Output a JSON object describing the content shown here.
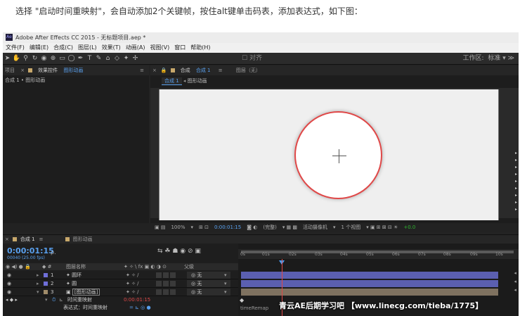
{
  "caption": "选择 \"启动时间重映射\"，会自动添加2个关键帧，按住alt键单击码表，添加表达式，如下图：",
  "window": {
    "logo": "Ae",
    "title": "Adobe After Effects CC 2015 - 无标题项目.aep *"
  },
  "menu": [
    "文件(F)",
    "编辑(E)",
    "合成(C)",
    "图层(L)",
    "效果(T)",
    "动画(A)",
    "视图(V)",
    "窗口",
    "帮助(H)"
  ],
  "toolbar": {
    "snap_label": "对齐",
    "workspace_label": "工作区:",
    "workspace_value": "标准"
  },
  "project_panel": {
    "tabs": [
      "项目",
      "效果控件",
      "图形动画"
    ],
    "breadcrumb": "合成 1 • 图形动画"
  },
  "comp_panel": {
    "tabs": [
      "合成",
      "合成 1",
      "图层（无）"
    ],
    "subtabs": [
      "合成 1",
      "图形动画"
    ],
    "status": {
      "zoom": "100%",
      "timecode": "0:00:01:15",
      "quality": "(完整)",
      "camera": "活动摄像机",
      "views": "1 个视图",
      "exposure": "+0.0"
    }
  },
  "timeline": {
    "tabs": [
      "合成 1",
      "图形动画"
    ],
    "timecode": "0:00:01:15",
    "fps": "00040 (25.00 fps)",
    "search_placeholder": "ρ.",
    "column_header": {
      "name": "图层名称",
      "parent": "父级"
    },
    "layers": [
      {
        "num": "1",
        "name": "圆环",
        "parent": "无",
        "color": "#6f6fd8"
      },
      {
        "num": "2",
        "name": "圆",
        "parent": "无",
        "color": "#6f6fd8"
      },
      {
        "num": "3",
        "name": "[图形动画]",
        "parent": "无",
        "color": "#a08c6a"
      }
    ],
    "properties": [
      {
        "name": "时间重映射",
        "value": "0:00:01:15"
      },
      {
        "name": "表达式：时间重映射",
        "value": ""
      }
    ],
    "ruler_ticks": [
      "0s",
      "01s",
      "02s",
      "03s",
      "04s",
      "05s",
      "06s",
      "07s",
      "08s",
      "09s",
      "10s"
    ],
    "expression_text": "timeRemap"
  },
  "watermark": "青云AE后期学习吧 【www.linecg.com/tieba/1775】"
}
